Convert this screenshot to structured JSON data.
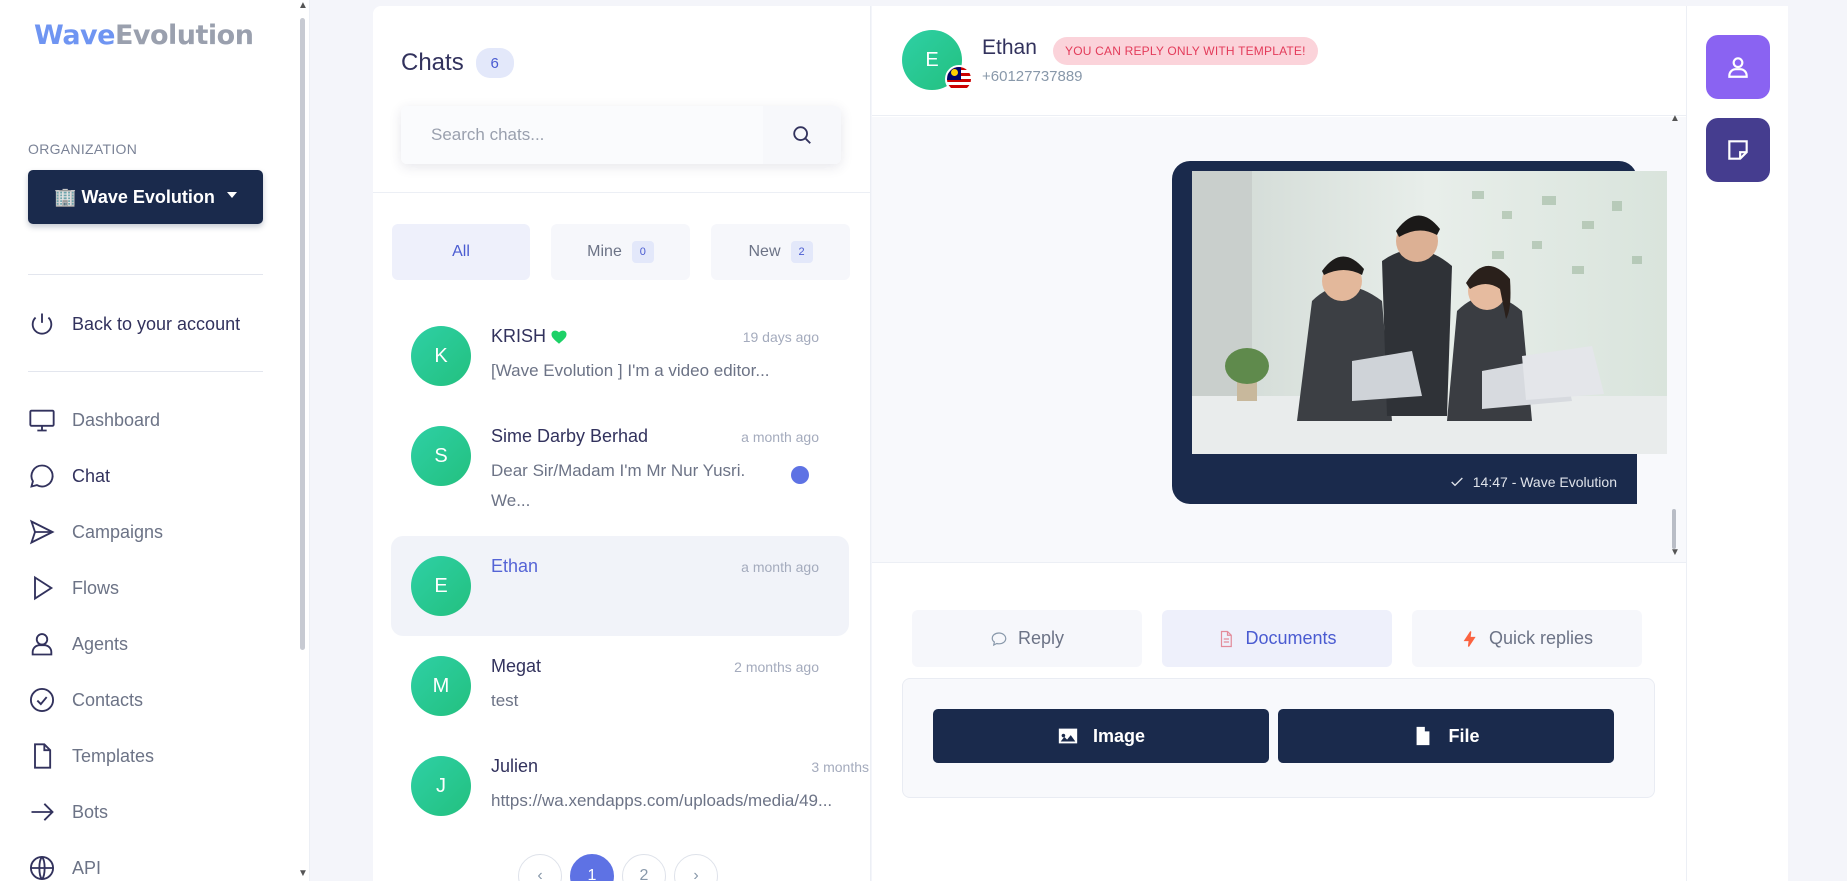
{
  "brand": {
    "part1": "Wave",
    "part2": "Evolution"
  },
  "sidebar": {
    "org_label": "ORGANIZATION",
    "org_name": "🏢 Wave Evolution",
    "back_label": "Back to your account",
    "items": [
      {
        "label": "Dashboard",
        "icon": "monitor-icon"
      },
      {
        "label": "Chat",
        "icon": "chat-bubble-icon"
      },
      {
        "label": "Campaigns",
        "icon": "send-icon"
      },
      {
        "label": "Flows",
        "icon": "play-icon"
      },
      {
        "label": "Agents",
        "icon": "user-icon"
      },
      {
        "label": "Contacts",
        "icon": "check-badge-icon"
      },
      {
        "label": "Templates",
        "icon": "document-icon"
      },
      {
        "label": "Bots",
        "icon": "arrow-right-icon"
      },
      {
        "label": "API",
        "icon": "globe-icon"
      }
    ]
  },
  "chats": {
    "title": "Chats",
    "count": "6",
    "search_placeholder": "Search chats...",
    "filters": [
      {
        "label": "All",
        "count": null
      },
      {
        "label": "Mine",
        "count": "0"
      },
      {
        "label": "New",
        "count": "2"
      }
    ],
    "items": [
      {
        "initial": "K",
        "name": "KRISH",
        "time": "19 days ago",
        "message": "[Wave Evolution ] I'm a video editor..."
      },
      {
        "initial": "S",
        "name": "Sime Darby Berhad",
        "time": "a month ago",
        "message": "Dear Sir/Madam I'm Mr Nur Yusri. We..."
      },
      {
        "initial": "E",
        "name": "Ethan",
        "time": "a month ago",
        "message": ""
      },
      {
        "initial": "M",
        "name": "Megat",
        "time": "2 months ago",
        "message": "test"
      },
      {
        "initial": "J",
        "name": "Julien",
        "time": "3 months",
        "message": "https://wa.xendapps.com/uploads/media/49..."
      }
    ],
    "pagination": {
      "prev": "‹",
      "pages": [
        "1",
        "2"
      ],
      "next": "›"
    }
  },
  "conversation": {
    "initial": "E",
    "name": "Ethan",
    "phone": "+60127737889",
    "warning": "YOU CAN REPLY ONLY WITH TEMPLATE!",
    "message_meta": "14:47 - Wave Evolution",
    "tabs": [
      {
        "label": "Reply",
        "icon": "chat-bubble-icon"
      },
      {
        "label": "Documents",
        "icon": "document-icon"
      },
      {
        "label": "Quick replies",
        "icon": "lightning-icon"
      }
    ],
    "attach": {
      "image_label": "Image",
      "file_label": "File"
    }
  },
  "colors": {
    "navy": "#1a2a4c",
    "accent": "#5e72e4",
    "green": "#2ed0a5",
    "warning": "#e33b5a"
  }
}
